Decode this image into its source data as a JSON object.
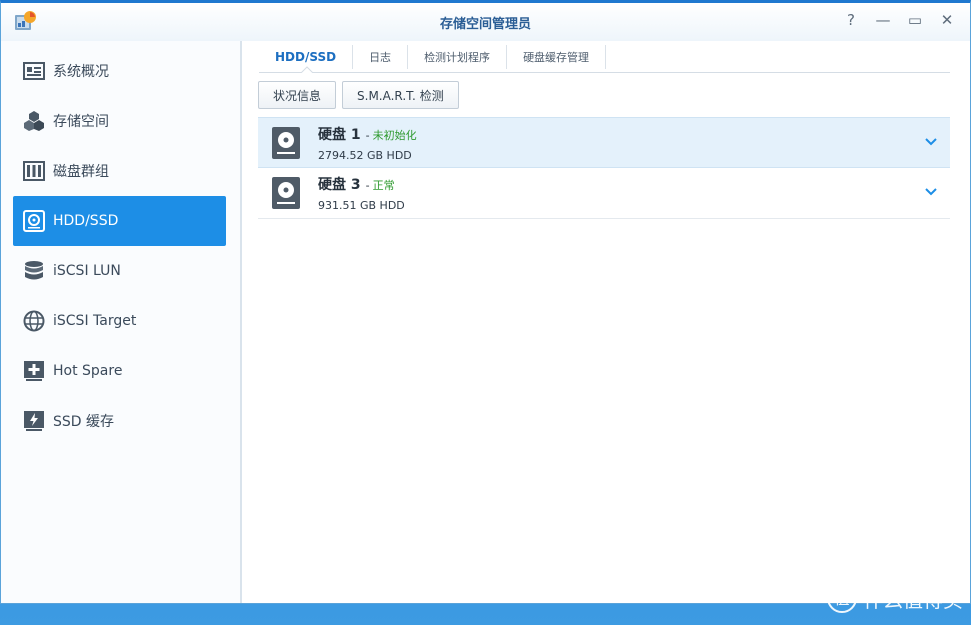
{
  "window": {
    "title": "存储空间管理员",
    "controls": {
      "help": "?",
      "minimize": "—",
      "maximize": "▭",
      "close": "✕"
    }
  },
  "sidebar": {
    "items": [
      {
        "label": "系统概况",
        "icon": "overview-icon",
        "active": false
      },
      {
        "label": "存储空间",
        "icon": "storage-cubes-icon",
        "active": false
      },
      {
        "label": "磁盘群组",
        "icon": "disk-group-icon",
        "active": false
      },
      {
        "label": "HDD/SSD",
        "icon": "hdd-icon",
        "active": true
      },
      {
        "label": "iSCSI LUN",
        "icon": "database-icon",
        "active": false
      },
      {
        "label": "iSCSI Target",
        "icon": "globe-icon",
        "active": false
      },
      {
        "label": "Hot Spare",
        "icon": "hot-spare-icon",
        "active": false
      },
      {
        "label": "SSD 缓存",
        "icon": "ssd-cache-icon",
        "active": false
      }
    ]
  },
  "tabs": [
    {
      "label": "HDD/SSD",
      "active": true
    },
    {
      "label": "日志",
      "active": false
    },
    {
      "label": "检测计划程序",
      "active": false
    },
    {
      "label": "硬盘缓存管理",
      "active": false
    }
  ],
  "toolbar": {
    "status_label": "状况信息",
    "smart_label": "S.M.A.R.T. 检测"
  },
  "disks": [
    {
      "name": "硬盘 1",
      "separator": "-",
      "status": "未初始化",
      "size": "2794.52 GB HDD",
      "selected": true
    },
    {
      "name": "硬盘 3",
      "separator": "-",
      "status": "正常",
      "size": "931.51 GB HDD",
      "selected": false
    }
  ],
  "watermark": {
    "badge": "值",
    "text": "什么值得买"
  },
  "colors": {
    "accent": "#1d8ee6",
    "title": "#2a5d95",
    "status_green": "#2e9a2e",
    "selected_row": "#e4f1fb"
  }
}
